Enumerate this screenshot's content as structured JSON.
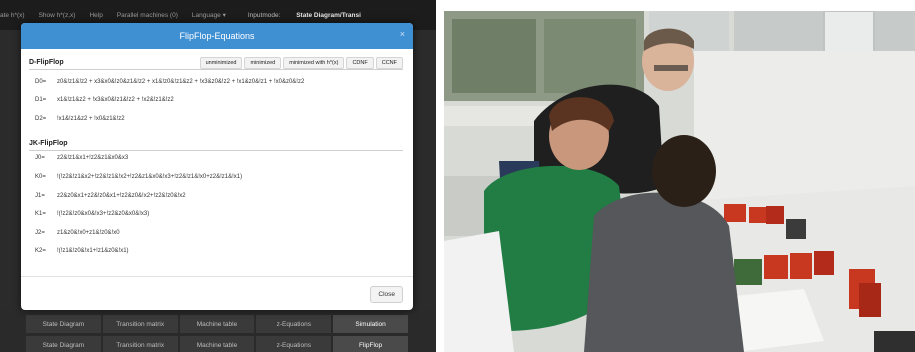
{
  "topbar": {
    "items": [
      "ate h*(x)",
      "Show h*(z,x)",
      "Help",
      "Parallel machines (0)",
      "Language ▾"
    ],
    "inputmode_label": "Inputmode:",
    "inputmode_value": "State Diagram/Transi"
  },
  "modal": {
    "title": "FlipFlop-Equations",
    "close_icon": "×",
    "sections": {
      "d": {
        "label": "D-FlipFlop",
        "buttons": [
          "unminimized",
          "minimized",
          "minimized with h*(x)",
          "CDNF",
          "CCNF"
        ],
        "equations": [
          {
            "name": "D0=",
            "expr": "z0&!z1&!z2 + x3&x0&!z0&z1&!z2 + x1&!z0&!z1&z2 + !x3&z0&!z2 + !x1&z0&!z1 + !x0&z0&!z2"
          },
          {
            "name": "D1=",
            "expr": "x1&!z1&z2 + !x3&x0&!z1&!z2 + !x2&!z1&!z2"
          },
          {
            "name": "D2=",
            "expr": "!x1&!z1&z2 + !x0&z1&!z2"
          }
        ]
      },
      "jk": {
        "label": "JK-FlipFlop",
        "equations": [
          {
            "name": "J0=",
            "expr": "z2&!z1&x1+!z2&z1&x0&x3"
          },
          {
            "name": "K0=",
            "expr": "!(!z2&!z1&x2+!z2&!z1&!x2+!z2&z1&x0&!x3+!z2&!z1&!x0+z2&!z1&!x1)"
          },
          {
            "name": "J1=",
            "expr": "z2&z0&x1+z2&!z0&x1+!z2&z0&!x2+!z2&!z0&!x2"
          },
          {
            "name": "K1=",
            "expr": "!(!z2&!z0&x0&!x3+!z2&z0&x0&!x3)"
          },
          {
            "name": "J2=",
            "expr": "z1&z0&!x0+z1&!z0&!x0"
          },
          {
            "name": "K2=",
            "expr": "!(!z1&!z0&!x1+!z1&z0&!x1)"
          }
        ]
      }
    },
    "close_button": "Close"
  },
  "bottom_tabs": {
    "row1": [
      "State Diagram",
      "Transition matrix",
      "Machine table",
      "z-Equations",
      "Simulation"
    ],
    "row2": [
      "State Diagram",
      "Transition matrix",
      "Machine table",
      "z-Equations",
      "FlipFlop"
    ]
  },
  "colors": {
    "header_blue": "#3f8fd3",
    "app_background": "#2b2b2b"
  }
}
